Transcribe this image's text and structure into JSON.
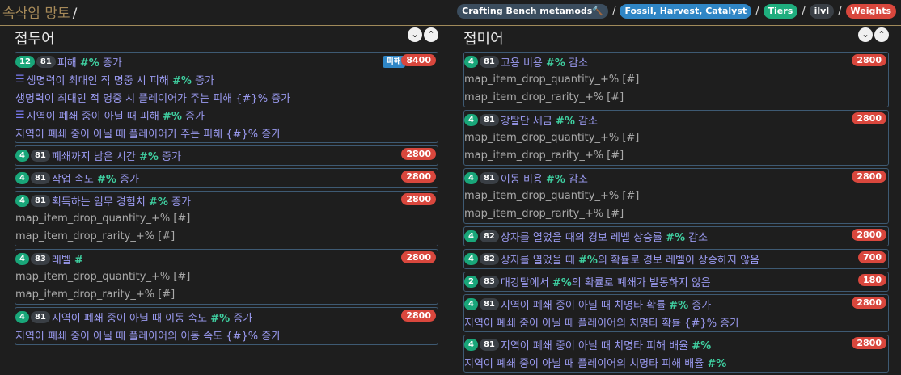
{
  "page": {
    "title": "속삭임 망토",
    "title_sep": "/"
  },
  "breadcrumbs": [
    {
      "label": "Crafting Bench metamods🔨",
      "style": "gray"
    },
    {
      "label": "Fossil, Harvest, Catalyst",
      "style": "blue"
    },
    {
      "label": "Tiers",
      "style": "green"
    },
    {
      "label": "ilvl",
      "style": "dark"
    },
    {
      "label": "Weights",
      "style": "red"
    }
  ],
  "crumb_sep": "/",
  "toggles": {
    "collapse": "⌄",
    "expand": "⌃"
  },
  "prefix": {
    "title": "접두어",
    "cards": [
      {
        "tier": "12",
        "ilvl": "81",
        "weight": "8400",
        "tag": "피해",
        "lines": [
          {
            "kind": "main",
            "pre": "피해 ",
            "hash": "#%",
            "post": " 증가"
          },
          {
            "kind": "icon",
            "pre": "생명력이 최대인 적 명중 시 피해 ",
            "hash": "#%",
            "post": " 증가"
          },
          {
            "kind": "plain",
            "pre": "생명력이 최대인 적 명중 시 플레이어가 주는 피해 {#}% 증가",
            "hash": "",
            "post": ""
          },
          {
            "kind": "icon",
            "pre": "지역이 폐쇄 중이 아닐 때 피해 ",
            "hash": "#%",
            "post": " 증가"
          },
          {
            "kind": "plain",
            "pre": "지역이 폐쇄 중이 아닐 때 플레이어가 주는 피해 {#}% 증가",
            "hash": "",
            "post": ""
          }
        ]
      },
      {
        "tier": "4",
        "ilvl": "81",
        "weight": "2800",
        "tag": "",
        "lines": [
          {
            "kind": "main",
            "pre": "폐쇄까지 남은 시간 ",
            "hash": "#%",
            "post": " 증가"
          }
        ]
      },
      {
        "tier": "4",
        "ilvl": "81",
        "weight": "2800",
        "tag": "",
        "lines": [
          {
            "kind": "main",
            "pre": "작업 속도 ",
            "hash": "#%",
            "post": " 증가"
          }
        ]
      },
      {
        "tier": "4",
        "ilvl": "81",
        "weight": "2800",
        "tag": "",
        "lines": [
          {
            "kind": "main",
            "pre": "획득하는 임무 경험치 ",
            "hash": "#%",
            "post": " 증가"
          },
          {
            "kind": "sub",
            "pre": "map_item_drop_quantity_+% [#]",
            "hash": "",
            "post": ""
          },
          {
            "kind": "sub",
            "pre": "map_item_drop_rarity_+% [#]",
            "hash": "",
            "post": ""
          }
        ]
      },
      {
        "tier": "4",
        "ilvl": "83",
        "weight": "2800",
        "tag": "",
        "lines": [
          {
            "kind": "main",
            "pre": "레벨 ",
            "hash": "#",
            "post": ""
          },
          {
            "kind": "sub",
            "pre": "map_item_drop_quantity_+% [#]",
            "hash": "",
            "post": ""
          },
          {
            "kind": "sub",
            "pre": "map_item_drop_rarity_+% [#]",
            "hash": "",
            "post": ""
          }
        ]
      },
      {
        "tier": "4",
        "ilvl": "81",
        "weight": "2800",
        "tag": "",
        "lines": [
          {
            "kind": "main",
            "pre": "지역이 폐쇄 중이 아닐 때 이동 속도 ",
            "hash": "#%",
            "post": " 증가"
          },
          {
            "kind": "plain",
            "pre": "지역이 폐쇄 중이 아닐 때 플레이어의 이동 속도 {#}% 증가",
            "hash": "",
            "post": ""
          }
        ]
      }
    ]
  },
  "suffix": {
    "title": "접미어",
    "cards": [
      {
        "tier": "4",
        "ilvl": "81",
        "weight": "2800",
        "tag": "",
        "lines": [
          {
            "kind": "main",
            "pre": "고용 비용 ",
            "hash": "#%",
            "post": " 감소"
          },
          {
            "kind": "sub",
            "pre": "map_item_drop_quantity_+% [#]",
            "hash": "",
            "post": ""
          },
          {
            "kind": "sub",
            "pre": "map_item_drop_rarity_+% [#]",
            "hash": "",
            "post": ""
          }
        ]
      },
      {
        "tier": "4",
        "ilvl": "81",
        "weight": "2800",
        "tag": "",
        "lines": [
          {
            "kind": "main",
            "pre": "강탈단 세금 ",
            "hash": "#%",
            "post": " 감소"
          },
          {
            "kind": "sub",
            "pre": "map_item_drop_quantity_+% [#]",
            "hash": "",
            "post": ""
          },
          {
            "kind": "sub",
            "pre": "map_item_drop_rarity_+% [#]",
            "hash": "",
            "post": ""
          }
        ]
      },
      {
        "tier": "4",
        "ilvl": "81",
        "weight": "2800",
        "tag": "",
        "lines": [
          {
            "kind": "main",
            "pre": "이동 비용 ",
            "hash": "#%",
            "post": " 감소"
          },
          {
            "kind": "sub",
            "pre": "map_item_drop_quantity_+% [#]",
            "hash": "",
            "post": ""
          },
          {
            "kind": "sub",
            "pre": "map_item_drop_rarity_+% [#]",
            "hash": "",
            "post": ""
          }
        ]
      },
      {
        "tier": "4",
        "ilvl": "82",
        "weight": "2800",
        "tag": "",
        "lines": [
          {
            "kind": "main",
            "pre": "상자를 열었을 때의 경보 레벨 상승률 ",
            "hash": "#%",
            "post": " 감소"
          }
        ]
      },
      {
        "tier": "4",
        "ilvl": "82",
        "weight": "700",
        "tag": "",
        "lines": [
          {
            "kind": "main",
            "pre": "상자를 열었을 때 ",
            "hash": "#%",
            "post": "의 확률로 경보 레벨이 상승하지 않음"
          }
        ]
      },
      {
        "tier": "2",
        "ilvl": "83",
        "weight": "180",
        "tag": "",
        "lines": [
          {
            "kind": "main",
            "pre": "대강탈에서 ",
            "hash": "#%",
            "post": "의 확률로 폐쇄가 발동하지 않음"
          }
        ]
      },
      {
        "tier": "4",
        "ilvl": "81",
        "weight": "2800",
        "tag": "",
        "lines": [
          {
            "kind": "main",
            "pre": "지역이 폐쇄 중이 아닐 때 치명타 확률 ",
            "hash": "#%",
            "post": " 증가"
          },
          {
            "kind": "plain",
            "pre": "지역이 폐쇄 중이 아닐 때 플레이어의 치명타 확률 {#}% 증가",
            "hash": "",
            "post": ""
          }
        ]
      },
      {
        "tier": "4",
        "ilvl": "81",
        "weight": "2800",
        "tag": "",
        "lines": [
          {
            "kind": "main",
            "pre": "지역이 폐쇄 중이 아닐 때 치명타 피해 배율 ",
            "hash": "#%",
            "post": ""
          },
          {
            "kind": "plain",
            "pre": "지역이 폐쇄 중이 아닐 때 플레이어의 치명타 피해 배율 ",
            "hash": "#%",
            "post": ""
          }
        ]
      }
    ]
  }
}
